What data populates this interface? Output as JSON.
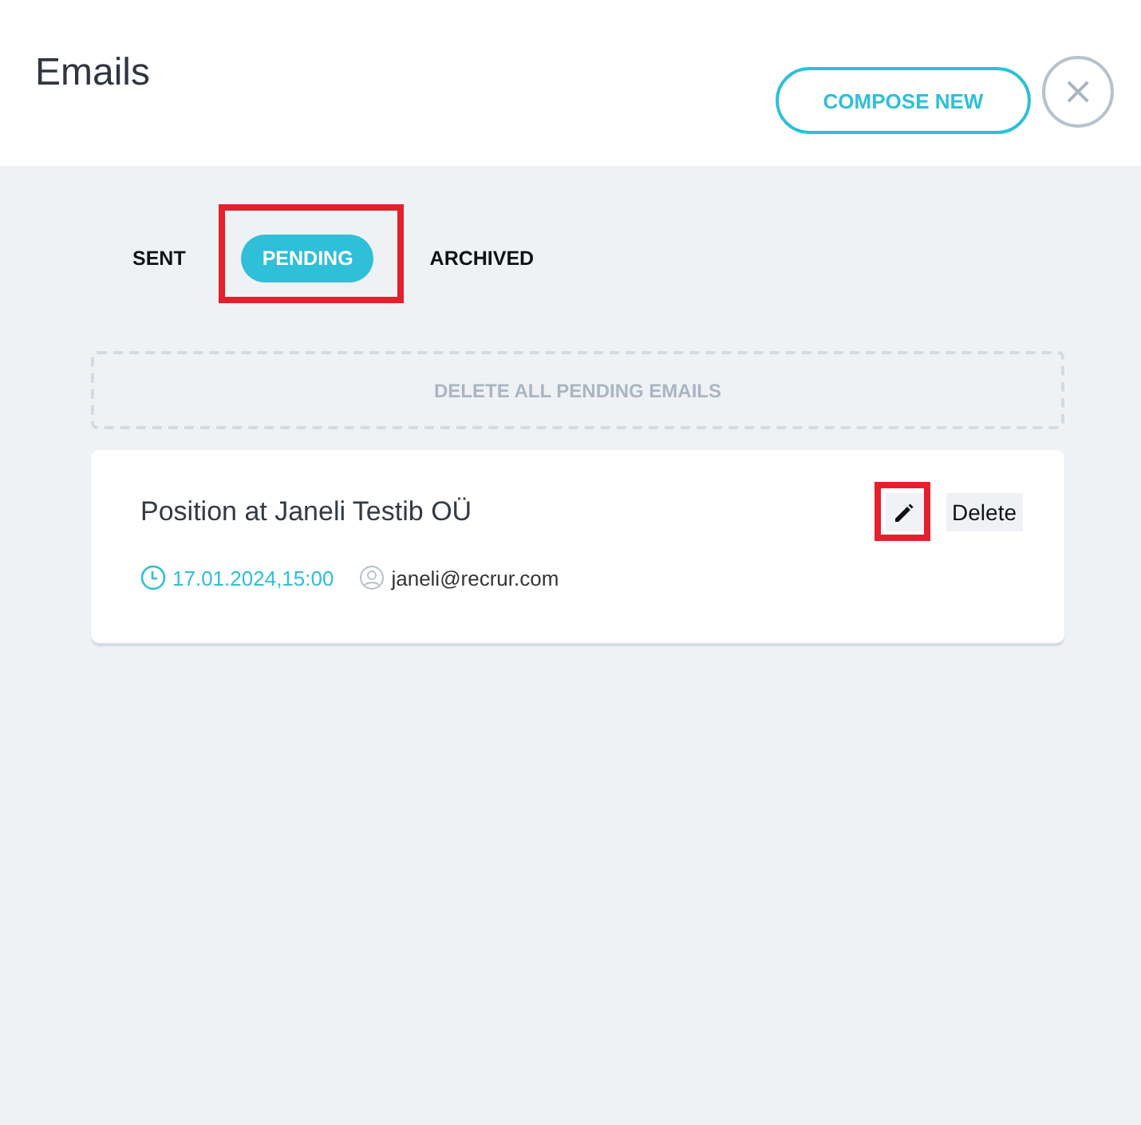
{
  "header": {
    "title": "Emails",
    "compose_button": "COMPOSE NEW",
    "close_button": "×"
  },
  "tabs": [
    {
      "label": "SENT",
      "selected": false,
      "highlighted": false
    },
    {
      "label": "PENDING",
      "selected": true,
      "highlighted": true
    },
    {
      "label": "ARCHIVED",
      "selected": false,
      "highlighted": false
    }
  ],
  "delete_all_button": "DELETE ALL PENDING EMAILS",
  "emails": [
    {
      "subject": "Position at Janeli Testib OÜ",
      "date": "17.01.2024,15:00",
      "recipient": "janeli@recrur.com",
      "edit_highlighted": true,
      "delete_button": "Delete"
    }
  ]
}
